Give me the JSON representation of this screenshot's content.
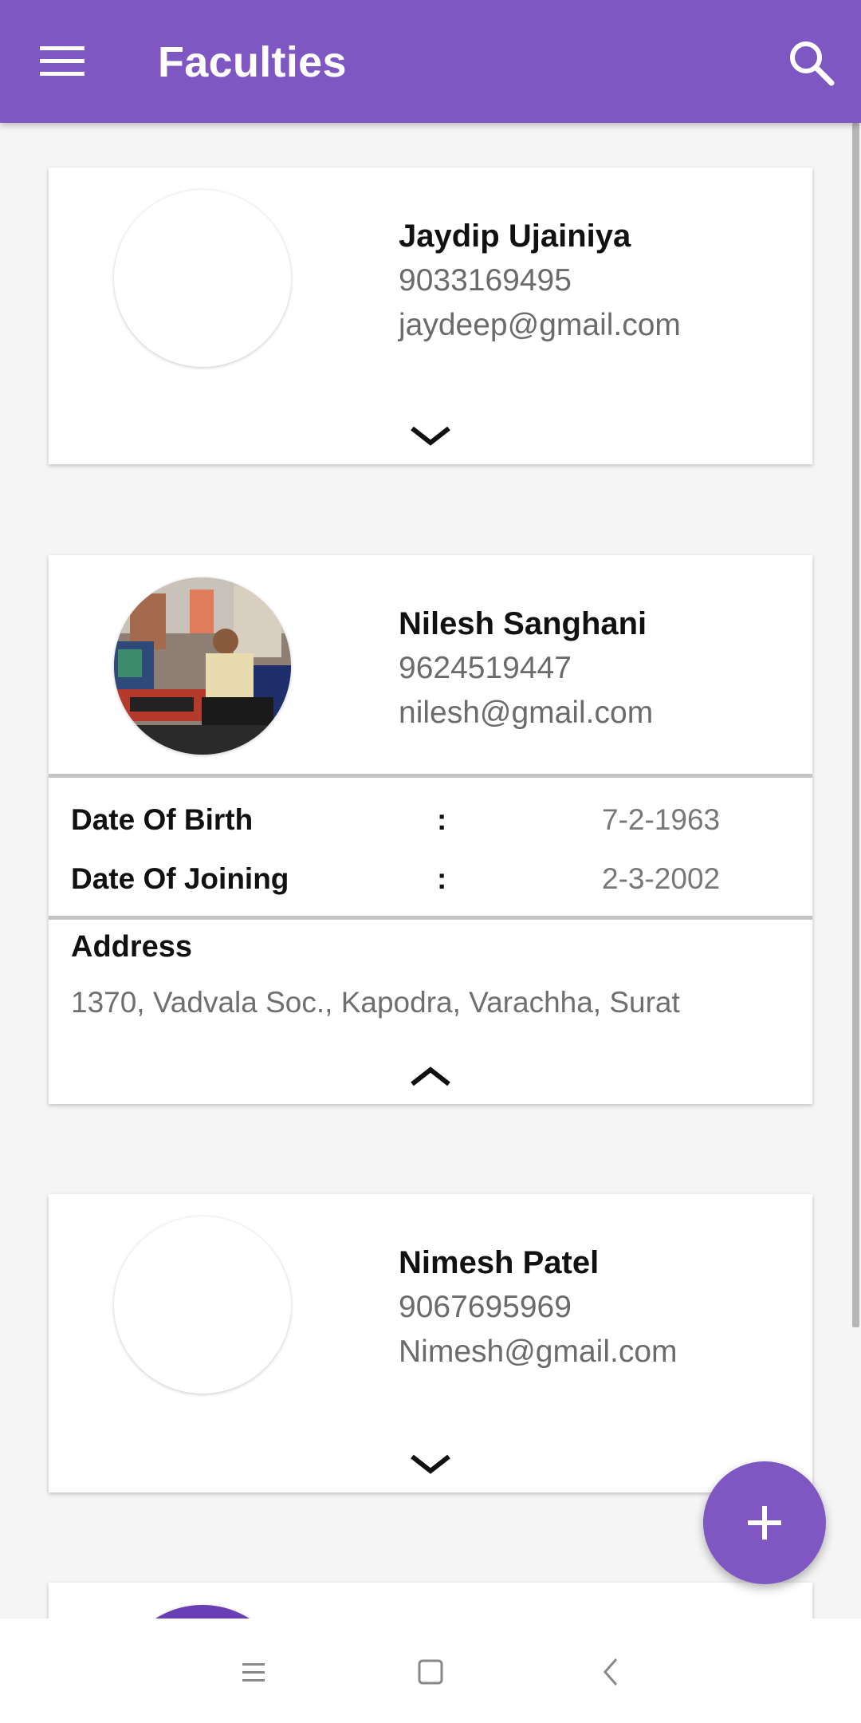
{
  "app_bar": {
    "title": "Faculties",
    "menu_icon": "hamburger-menu-icon",
    "search_icon": "search-icon",
    "color": "#7e57c2"
  },
  "faculties": [
    {
      "name": "Jaydip Ujainiya",
      "phone": "9033169495",
      "email": "jaydeep@gmail.com",
      "expanded": false,
      "toggle_icon": "chevron-down-icon"
    },
    {
      "name": "Nilesh Sanghani",
      "phone": "9624519447",
      "email": "nilesh@gmail.com",
      "expanded": true,
      "toggle_icon": "chevron-up-icon",
      "details": {
        "dob_label": "Date Of Birth",
        "dob_sep": ":",
        "dob_value": "7-2-1963",
        "doj_label": "Date Of Joining",
        "doj_sep": ":",
        "doj_value": "2-3-2002",
        "address_label": "Address",
        "address_value": "1370, Vadvala Soc., Kapodra, Varachha, Surat"
      }
    },
    {
      "name": "Nimesh Patel",
      "phone": "9067695969",
      "email": "Nimesh@gmail.com",
      "expanded": false,
      "toggle_icon": "chevron-down-icon"
    }
  ],
  "fab": {
    "icon": "plus-icon"
  },
  "system_nav": {
    "recents_icon": "recents-icon",
    "home_icon": "home-icon",
    "back_icon": "back-icon"
  }
}
